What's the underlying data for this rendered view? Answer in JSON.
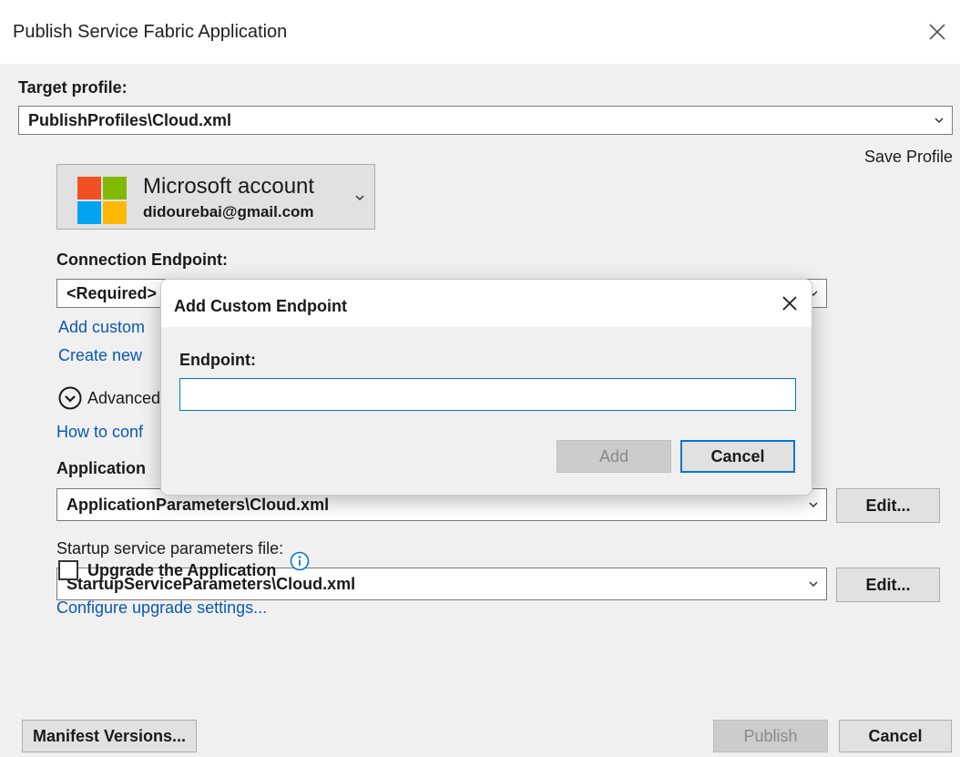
{
  "window": {
    "title": "Publish Service Fabric Application",
    "close_icon": "close-icon"
  },
  "target_profile": {
    "label": "Target profile:",
    "value": "PublishProfiles\\Cloud.xml"
  },
  "save_profile": "Save Profile",
  "account": {
    "name": "Microsoft account",
    "email": "didourebai@gmail.com",
    "logo_colors": [
      "#f25022",
      "#7fba00",
      "#00a4ef",
      "#ffb900"
    ]
  },
  "connection": {
    "label": "Connection Endpoint:",
    "value": "<Required>",
    "add_custom_link": "Add custom",
    "create_new_link": "Create new"
  },
  "advanced": {
    "label": "Advanced",
    "help_link": "How to conf"
  },
  "application": {
    "label": "Application",
    "value": "ApplicationParameters\\Cloud.xml",
    "edit_label": "Edit..."
  },
  "startup": {
    "label": "Startup service parameters file:",
    "value": "StartupServiceParameters\\Cloud.xml",
    "edit_label": "Edit..."
  },
  "upgrade": {
    "label": "Upgrade the Application",
    "checked": false,
    "configure_link": "Configure upgrade settings..."
  },
  "footer": {
    "manifest_label": "Manifest Versions...",
    "publish_label": "Publish",
    "cancel_label": "Cancel"
  },
  "dialog": {
    "title": "Add Custom Endpoint",
    "endpoint_label": "Endpoint:",
    "endpoint_value": "",
    "add_label": "Add",
    "cancel_label": "Cancel"
  },
  "colors": {
    "link": "#0b58b4",
    "accent": "#0078d7",
    "background": "#f0f0f0"
  }
}
